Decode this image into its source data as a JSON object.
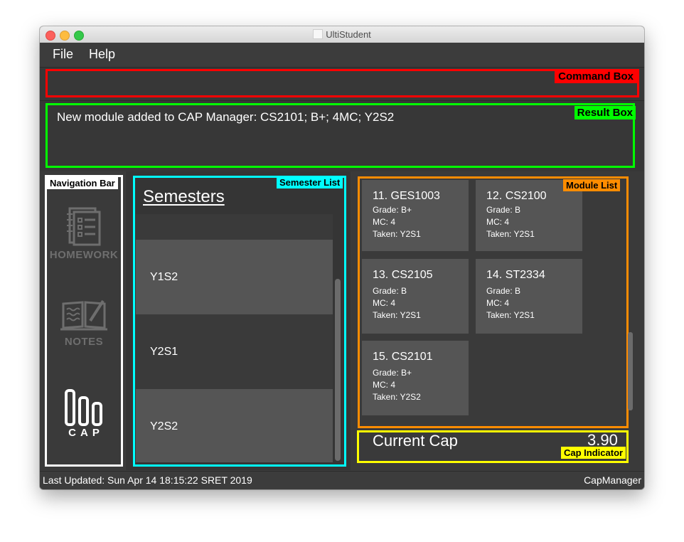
{
  "window": {
    "title": "UltiStudent"
  },
  "menu": {
    "items": [
      "File",
      "Help"
    ]
  },
  "annotations": {
    "command_box": "Command Box",
    "result_box": "Result Box",
    "navigation_bar": "Navigation Bar",
    "semester_list": "Semester List",
    "module_list": "Module List",
    "cap_indicator": "Cap Indicator"
  },
  "command": {
    "value": ""
  },
  "result": {
    "text": "New module added to CAP Manager: CS2101; B+; 4MC; Y2S2"
  },
  "navigation": {
    "items": [
      {
        "label": "HOMEWORK",
        "icon": "homework-icon"
      },
      {
        "label": "NOTES",
        "icon": "notes-icon"
      },
      {
        "label": "CAP",
        "icon": "cap-icon"
      }
    ]
  },
  "semesters": {
    "title": "Semesters",
    "items": [
      "Y1S2",
      "Y2S1",
      "Y2S2"
    ]
  },
  "modules": {
    "items": [
      {
        "title": "11.  GES1003",
        "grade": "Grade: B+",
        "mc": "MC: 4",
        "taken": "Taken: Y2S1"
      },
      {
        "title": "12.  CS2100",
        "grade": "Grade: B",
        "mc": "MC: 4",
        "taken": "Taken: Y2S1"
      },
      {
        "title": "13.  CS2105",
        "grade": "Grade: B",
        "mc": "MC: 4",
        "taken": "Taken: Y2S1"
      },
      {
        "title": "14.  ST2334",
        "grade": "Grade: B",
        "mc": "MC: 4",
        "taken": "Taken: Y2S1"
      },
      {
        "title": "15.  CS2101",
        "grade": "Grade: B+",
        "mc": "MC: 4",
        "taken": "Taken: Y2S2"
      }
    ]
  },
  "cap": {
    "label": "Current Cap",
    "value": "3.90"
  },
  "status": {
    "last_updated": "Last Updated: Sun Apr 14 18:15:22 SRET 2019",
    "app": "CapManager"
  },
  "colors": {
    "command_box": "#ff0000",
    "result_box": "#00ff00",
    "navigation_bar": "#ffffff",
    "semester_list": "#00ffff",
    "module_list": "#ff8c00",
    "cap_indicator": "#ffff00",
    "card_bg": "#555555",
    "nav_inactive": "#6e6e6e"
  }
}
